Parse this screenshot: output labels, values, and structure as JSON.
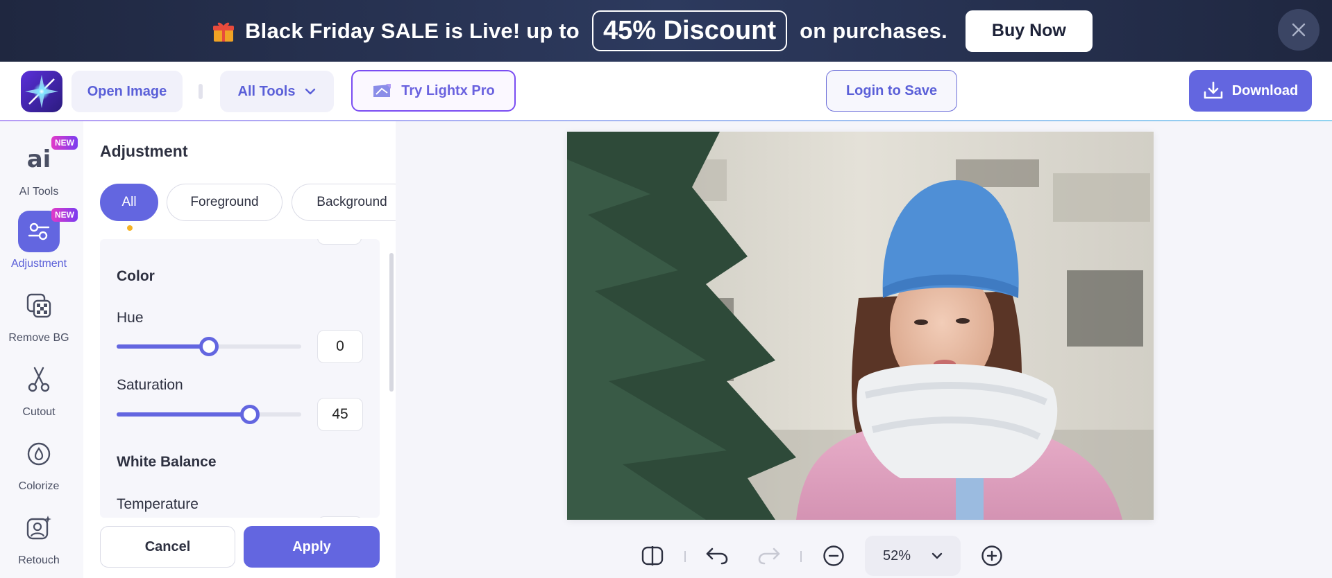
{
  "promo": {
    "text_before": "Black Friday SALE is Live! up to",
    "discount": "45% Discount",
    "text_after": "on purchases.",
    "button": "Buy Now"
  },
  "toolbar": {
    "open_image": "Open Image",
    "all_tools": "All Tools",
    "try_pro": "Try Lightx Pro",
    "login": "Login to Save",
    "download": "Download"
  },
  "rail": {
    "items": [
      {
        "label": "AI Tools",
        "icon": "ai-icon",
        "badge": "NEW"
      },
      {
        "label": "Adjustment",
        "icon": "adjustment-icon",
        "badge": "NEW",
        "active": true
      },
      {
        "label": "Remove BG",
        "icon": "remove-bg-icon"
      },
      {
        "label": "Cutout",
        "icon": "scissors-icon"
      },
      {
        "label": "Colorize",
        "icon": "drop-icon"
      },
      {
        "label": "Retouch",
        "icon": "retouch-icon"
      }
    ]
  },
  "panel": {
    "title": "Adjustment",
    "filters": [
      "All",
      "Foreground",
      "Background"
    ],
    "active_filter": "All",
    "sections": {
      "color": "Color",
      "white_balance": "White Balance"
    },
    "fields": {
      "hue": {
        "label": "Hue",
        "value": "0",
        "level": 0.5
      },
      "saturation": {
        "label": "Saturation",
        "value": "45",
        "level": 0.72
      },
      "temperature": {
        "label": "Temperature"
      }
    },
    "cancel": "Cancel",
    "apply": "Apply"
  },
  "canvas": {
    "zoom": "52%"
  },
  "colors": {
    "accent": "#6366e0",
    "banner": "#1f2740",
    "badge_gradient": [
      "#e23ac8",
      "#7a3cf0"
    ],
    "dot": "#f5b323"
  }
}
